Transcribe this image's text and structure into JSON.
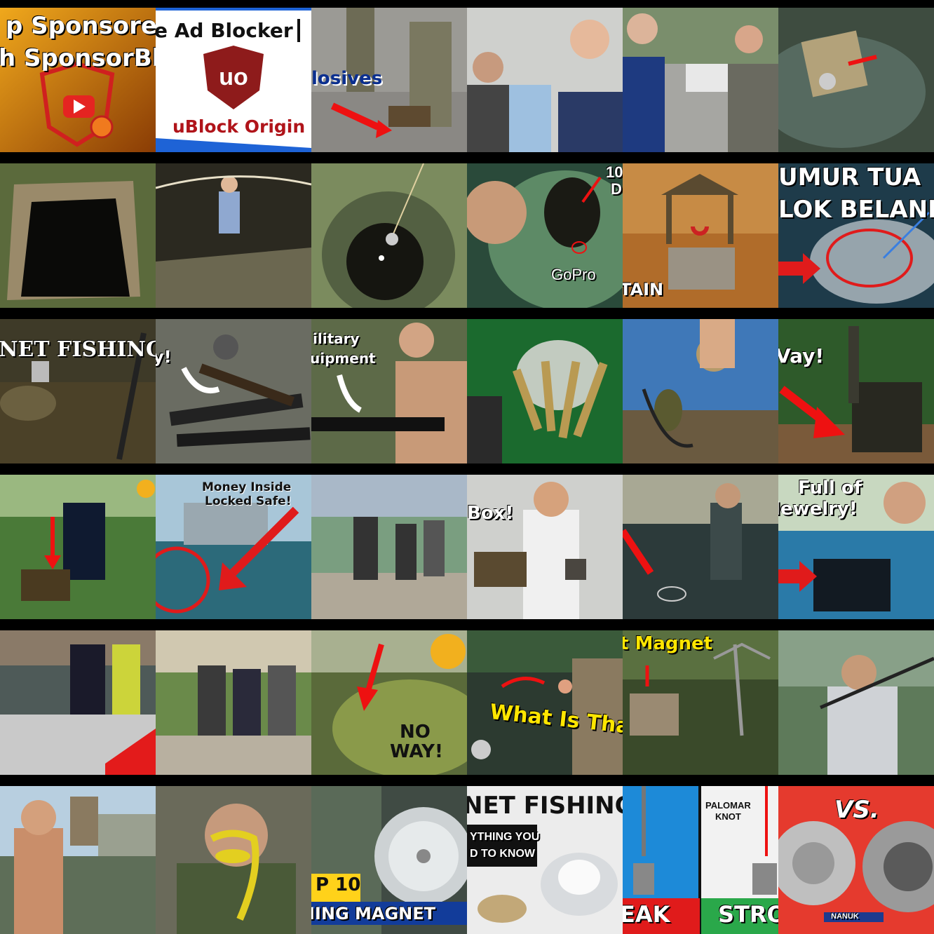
{
  "tiles": {
    "r1c1": "p Sponsored",
    "r1c1b": "h SponsorBlo",
    "r1c2": "e Ad Blocker",
    "r1c2b": "uBlock Origin",
    "r1c3": "losives",
    "r2c4a": "10",
    "r2c4b": "D",
    "r2c4c": "GoPro",
    "r2c5": "TAIN",
    "r2c6a": "UMUR TUA",
    "r2c6b": "LOK BELAND",
    "r3c1": "NET FISHING",
    "r3c2": "y!",
    "r3c3a": "ilitary",
    "r3c3b": "uipment",
    "r3c6": "Vay!",
    "r4c2a": "Money Inside",
    "r4c2b": "Locked Safe!",
    "r4c4": "Box!",
    "r4c6a": "Full of",
    "r4c6b": "lewelry!",
    "r5c3a": "NO",
    "r5c3b": "WAY!",
    "r5c4": "What Is That",
    "r5c5": "t Magnet",
    "r6c3a": "P 10",
    "r6c3b": "IING MAGNET",
    "r6c4a": "NET FISHING",
    "r6c4b": "YTHING YOU",
    "r6c4c": "D TO KNOW",
    "r6c5a": "EAK",
    "r6c5b": "STRO",
    "r6c5c": "PALOMAR",
    "r6c5d": "KNOT",
    "r6c6a": "VS.",
    "r6c6b": "NANUK"
  },
  "colors": {
    "accent_red": "#e51b1b",
    "ublock_red": "#8e1b1b",
    "yellow": "#ffe600",
    "blue": "#1565c0"
  }
}
